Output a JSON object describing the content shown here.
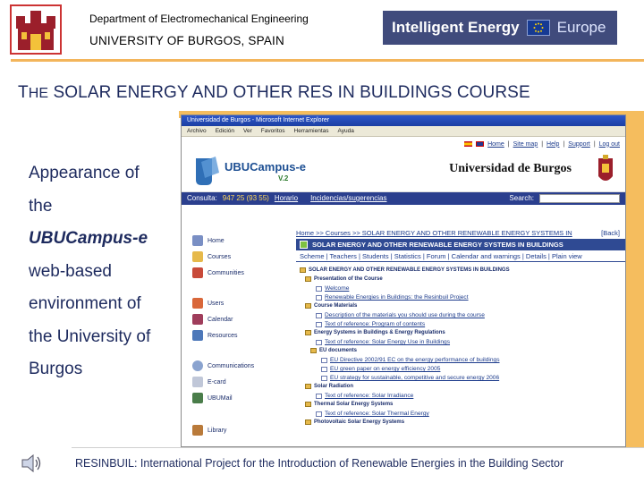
{
  "header": {
    "department": "Department of Electromechanical Engineering",
    "university": "UNIVERSITY OF BURGOS, SPAIN",
    "banner_text": "Intelligent Energy",
    "banner_europa": "Europe"
  },
  "course_title": {
    "prefix": "T",
    "prefix_small": "HE",
    "rest": " SOLAR ENERGY AND OTHER RES IN BUILDINGS COURSE"
  },
  "left_text": {
    "line1": "Appearance of",
    "line2": "the",
    "line3": "UBUCampus-e",
    "line4": "web-based",
    "line5": "environment of",
    "line6": "the University of",
    "line7": "Burgos"
  },
  "browser": {
    "title": "Universidad de Burgos - Microsoft Internet Explorer",
    "menu": [
      "Archivo",
      "Edición",
      "Ver",
      "Favoritos",
      "Herramientas",
      "Ayuda"
    ],
    "top_links": [
      "Home",
      "Site map",
      "Help",
      "Support",
      "Log out"
    ],
    "site_title": "Universidad de Burgos",
    "ubu_logo_text": "UBUCampus-e",
    "ubu_version": "V.2",
    "consulta_label": "Consulta:",
    "consulta_phone": "947 25 (93 55)",
    "horario": "Horario",
    "incidencias": "Incidencias/sugerencias",
    "search_label": "Search:",
    "breadcrumb": "Home >> Courses >> SOLAR ENERGY AND OTHER RENEWABLE ENERGY SYSTEMS IN BUILDINGS",
    "back": "[Back]",
    "section_title": "SOLAR ENERGY AND OTHER RENEWABLE ENERGY SYSTEMS IN BUILDINGS",
    "tabs": "Scheme | Teachers | Students | Statistics | Forum | Calendar and warnings | Details | Plain view",
    "sidebar": [
      "Home",
      "Courses",
      "Communities",
      "Users",
      "Calendar",
      "Resources",
      "Communications",
      "E-card",
      "UBUMail",
      "Library"
    ],
    "tree": [
      {
        "type": "folder",
        "text": "SOLAR ENERGY AND OTHER RENEWABLE ENERGY SYSTEMS IN BUILDINGS"
      },
      {
        "type": "folder",
        "text": "Presentation of the Course"
      },
      {
        "type": "doc",
        "text": "Welcome"
      },
      {
        "type": "doc",
        "text": "Renewable Energies in Buildings: the Resinbuil Project"
      },
      {
        "type": "folder",
        "text": "Course Materials"
      },
      {
        "type": "doc",
        "text": "Description of the materials you should use during the course"
      },
      {
        "type": "doc",
        "text": "Text of reference: Program of contents"
      },
      {
        "type": "folder",
        "text": "Energy Systems in Buildings & Energy Regulations"
      },
      {
        "type": "doc",
        "text": "Text of reference: Solar Energy Use in Buildings"
      },
      {
        "type": "folder",
        "text": "EU documents"
      },
      {
        "type": "doc",
        "text": "EU Directive 2002/91 EC on the energy performance of buildings"
      },
      {
        "type": "doc",
        "text": "EU green paper on energy efficiency 2005"
      },
      {
        "type": "doc",
        "text": "EU strategy for sustainable, competitive and secure energy 2006"
      },
      {
        "type": "folder",
        "text": "Solar Radiation"
      },
      {
        "type": "doc",
        "text": "Text of reference: Solar Irradiance"
      },
      {
        "type": "folder",
        "text": "Thermal Solar Energy Systems"
      },
      {
        "type": "doc",
        "text": "Text of reference: Solar Thermal Energy"
      },
      {
        "type": "folder",
        "text": "Photovoltaic Solar Energy Systems"
      }
    ]
  },
  "footer": {
    "text": "RESINBUIL: International Project for the Introduction of Renewable Energies in the Building Sector"
  },
  "colors": {
    "accent_orange": "#f5bd5e",
    "title_navy": "#1d2a5e",
    "site_blue": "#2b3f8e"
  }
}
